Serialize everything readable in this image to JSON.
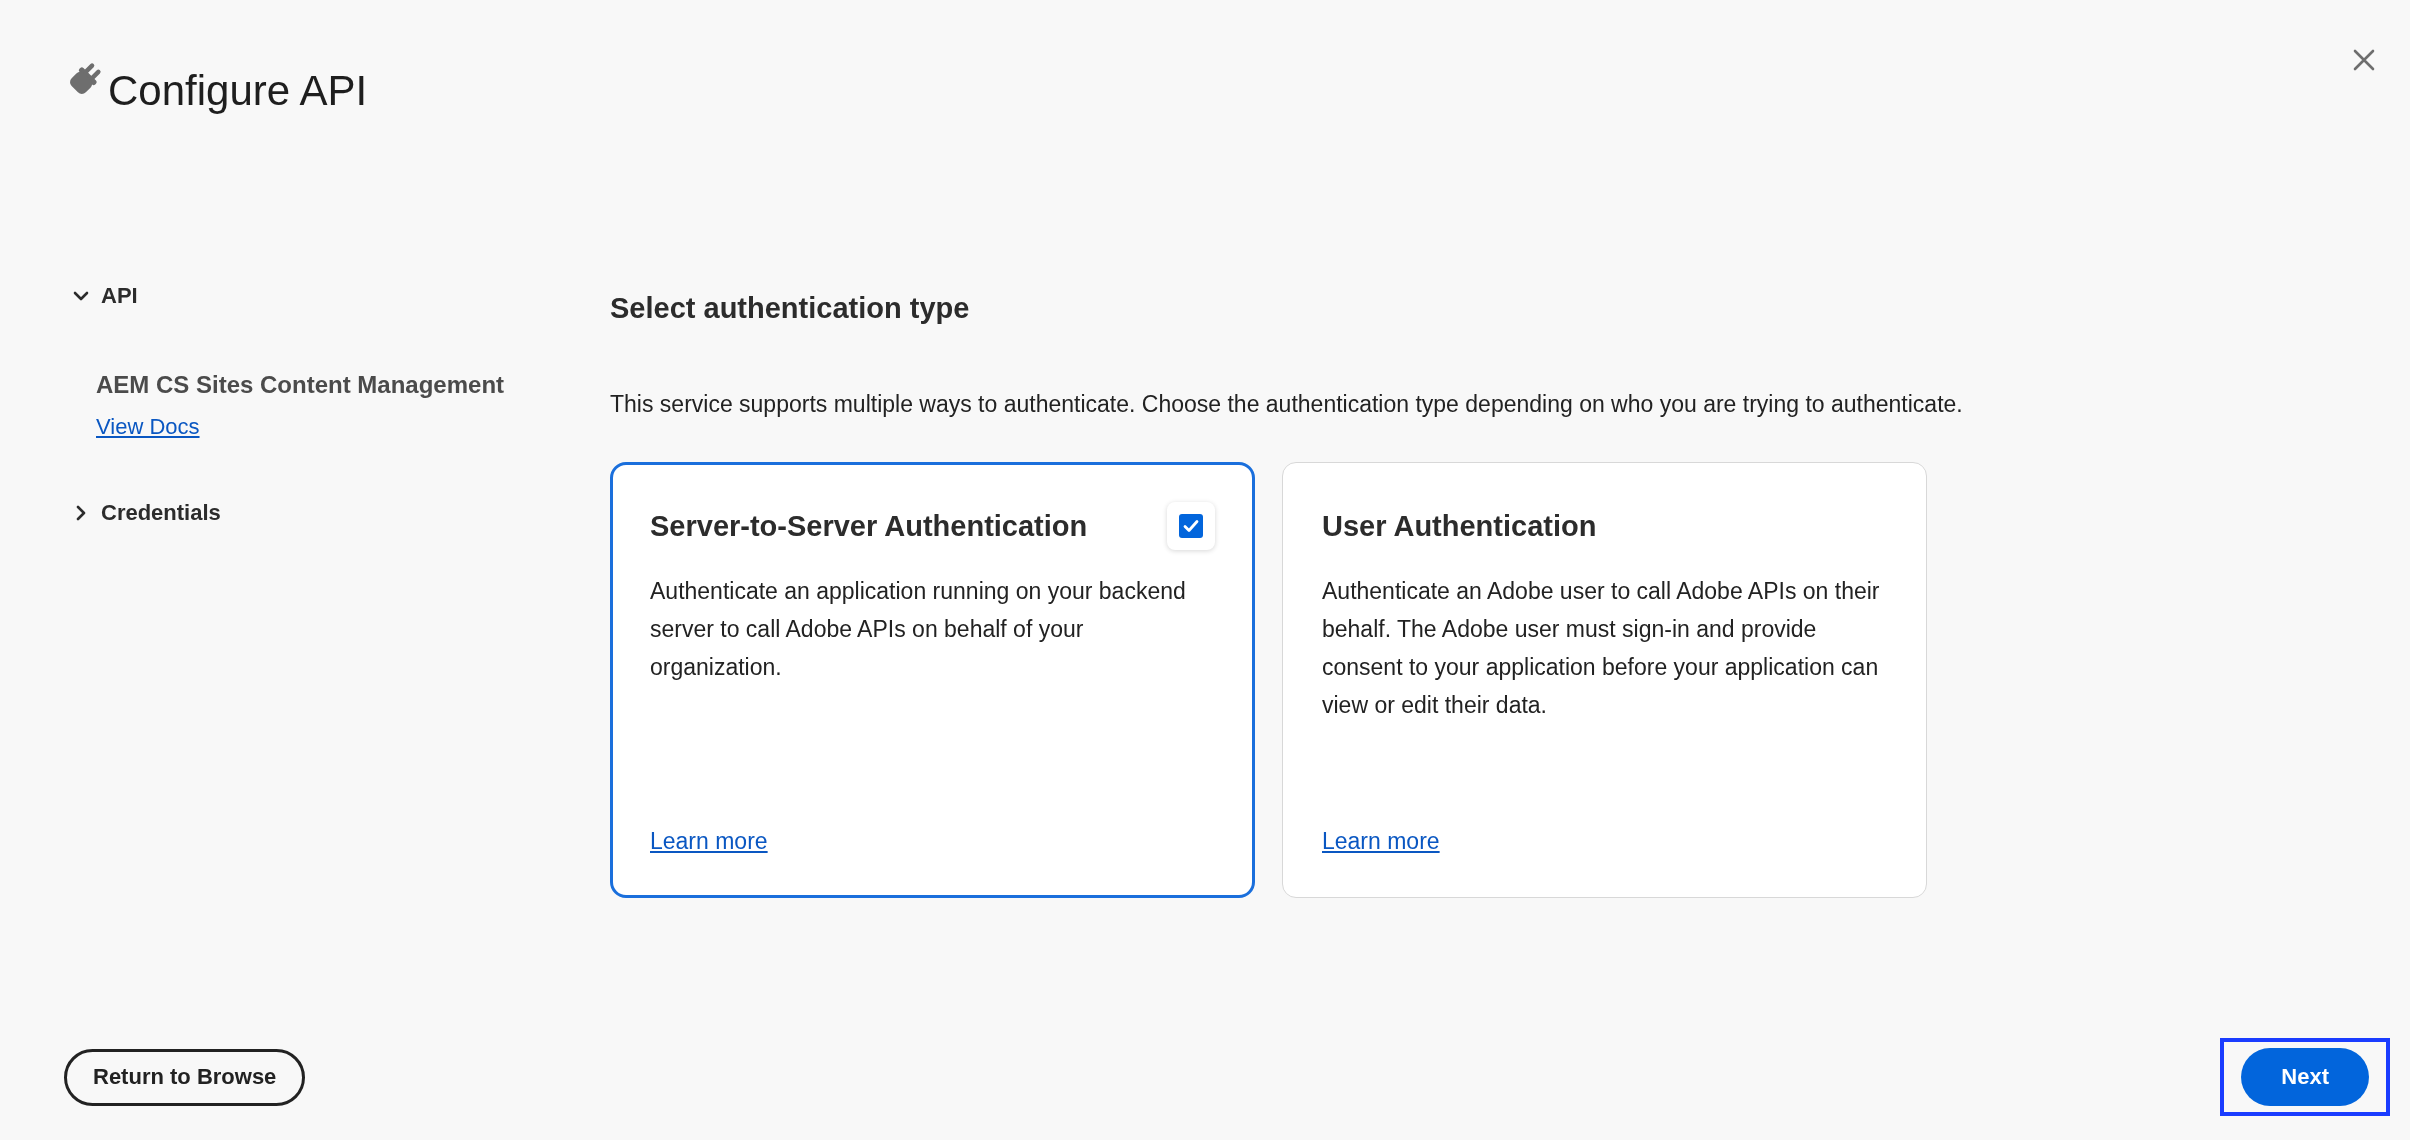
{
  "dialog": {
    "title": "Configure API"
  },
  "sidebar": {
    "sections": [
      {
        "label": "API",
        "expanded": true,
        "children": [
          {
            "label": "AEM CS Sites Content Management",
            "link": "View Docs"
          }
        ]
      },
      {
        "label": "Credentials",
        "expanded": false
      }
    ]
  },
  "main": {
    "heading": "Select authentication type",
    "description": "This service supports multiple ways to authenticate. Choose the authentication type depending on who you are trying to authenticate.",
    "options": [
      {
        "title": "Server-to-Server Authentication",
        "description": "Authenticate an application running on your backend server to call Adobe APIs on behalf of your organization.",
        "link": "Learn more",
        "selected": true
      },
      {
        "title": "User Authentication",
        "description": "Authenticate an Adobe user to call Adobe APIs on their behalf. The Adobe user must sign-in and provide consent to your application before your application can view or edit their data.",
        "link": "Learn more",
        "selected": false
      }
    ]
  },
  "footer": {
    "buttons": [
      {
        "label": "Return to Browse",
        "kind": "secondary",
        "highlighted": false
      },
      {
        "label": "Next",
        "kind": "primary",
        "highlighted": true
      }
    ]
  }
}
